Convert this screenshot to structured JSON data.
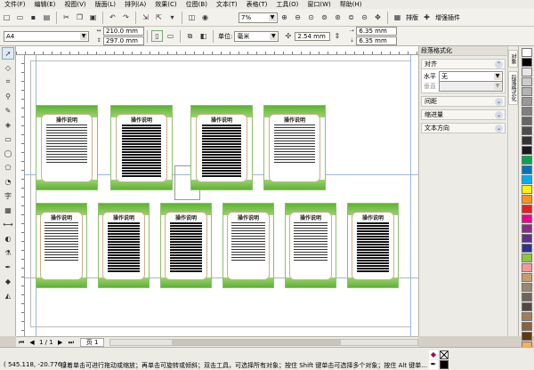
{
  "menubar": {
    "items": [
      {
        "label": "文件(F)"
      },
      {
        "label": "编辑(E)"
      },
      {
        "label": "视图(V)"
      },
      {
        "label": "版面(L)"
      },
      {
        "label": "排列(A)"
      },
      {
        "label": "效果(C)"
      },
      {
        "label": "位图(B)"
      },
      {
        "label": "文本(T)"
      },
      {
        "label": "表格(T)"
      },
      {
        "label": "工具(O)"
      },
      {
        "label": "窗口(W)"
      },
      {
        "label": "帮助(H)"
      }
    ]
  },
  "toolbar1": {
    "zoom_value": "7%",
    "layout_label": "排版",
    "plugin_label": "增强插件"
  },
  "toolbar2": {
    "paper_size": "A4",
    "width_value": "210.0 mm",
    "height_value": "297.0 mm",
    "units_label": "单位:",
    "units_value": "毫米",
    "nudge_value": "2.54 mm",
    "dup_x": "6.35 mm",
    "dup_y": "6.35 mm"
  },
  "documents": {
    "title": "操作说明"
  },
  "docker": {
    "title": "段落格式化",
    "panels": {
      "align": {
        "label": "对齐",
        "horizontal_label": "水平",
        "horizontal_value": "无",
        "vertical_label": "垂直"
      },
      "spacing": {
        "label": "间距"
      },
      "indent": {
        "label": "缩进量"
      },
      "direction": {
        "label": "文本方向"
      }
    },
    "tabs": [
      "对象",
      "段落格式化"
    ]
  },
  "page_nav": {
    "counter": "1 / 1",
    "page_tab": "页 1"
  },
  "status": {
    "coords": "( 545.118, -20.776 )",
    "hint": "接着单击可进行拖动或缩放；再单击可旋转或倾斜；双击工具，可选择所有对象；按住 Shift 键单击可选择多个对象；按住 Alt 键单..."
  },
  "palette": {
    "colors": [
      "#ffffff",
      "#000000",
      "#e6e6e6",
      "#cccccc",
      "#b3b3b3",
      "#999999",
      "#808080",
      "#666666",
      "#4d4d4d",
      "#333333",
      "#1a1a1a",
      "#00a651",
      "#0072bc",
      "#00aeef",
      "#fff200",
      "#f7941d",
      "#ed1c24",
      "#ec008c",
      "#92278f",
      "#662d91",
      "#2e3192",
      "#8dc63f",
      "#f5989d",
      "#c69c6d",
      "#998675",
      "#736357",
      "#534741",
      "#a67c52",
      "#8c6239",
      "#603913",
      "#fbaf5d"
    ]
  },
  "colors": {
    "accent_green": "#5fb334",
    "chrome": "#ecebe6"
  }
}
